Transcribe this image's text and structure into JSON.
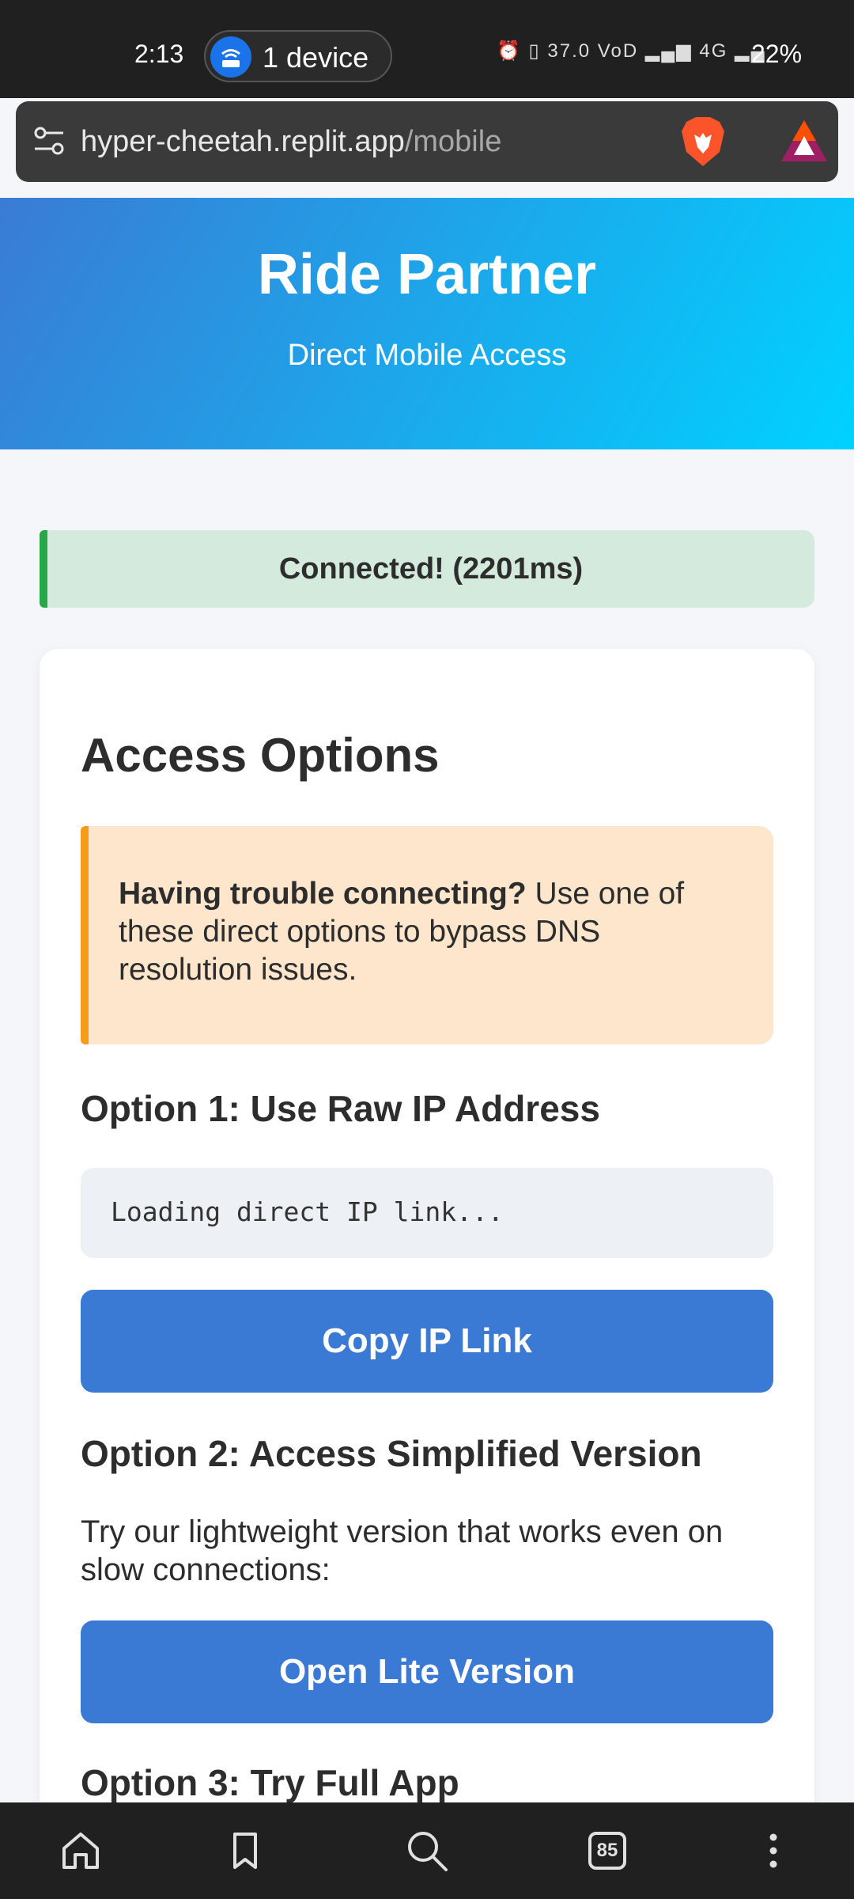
{
  "status_bar": {
    "time": "2:13",
    "device_label": "1 device",
    "icons_text": "⏰ ▯ 37.0 VoD ▂▄▆ 4G ▂▄",
    "battery": "22%"
  },
  "address_bar": {
    "domain": "hyper-cheetah.replit.app",
    "path": "/mobile",
    "tune_icon": "tune-icon",
    "brave_icon": "brave-lion-icon",
    "rewards_icon": "bat-rewards-icon"
  },
  "header": {
    "title": "Ride Partner",
    "subtitle": "Direct Mobile Access",
    "gradient_start": "#3a7bd5",
    "gradient_end": "#00d2ff"
  },
  "connection": {
    "message": "Connected! (2201ms)",
    "color": "#28a745"
  },
  "card": {
    "title": "Access Options",
    "warning": {
      "bold": "Having trouble connecting?",
      "text": " Use one of these direct options to bypass DNS resolution issues.",
      "accent": "#f59c1a"
    },
    "option1": {
      "title": "Option 1: Use Raw IP Address",
      "code": "Loading direct IP link...",
      "button": "Copy IP Link"
    },
    "option2": {
      "title": "Option 2: Access Simplified Version",
      "description": "Try our lightweight version that works even on slow connections:",
      "button": "Open Lite Version"
    },
    "option3": {
      "title": "Option 3: Try Full App"
    },
    "button_color": "#3b7ad4"
  },
  "bottom_nav": {
    "items": [
      "home-icon",
      "bookmark-icon",
      "search-icon",
      "tabs-icon",
      "more-icon"
    ],
    "tabs_count": "85"
  }
}
